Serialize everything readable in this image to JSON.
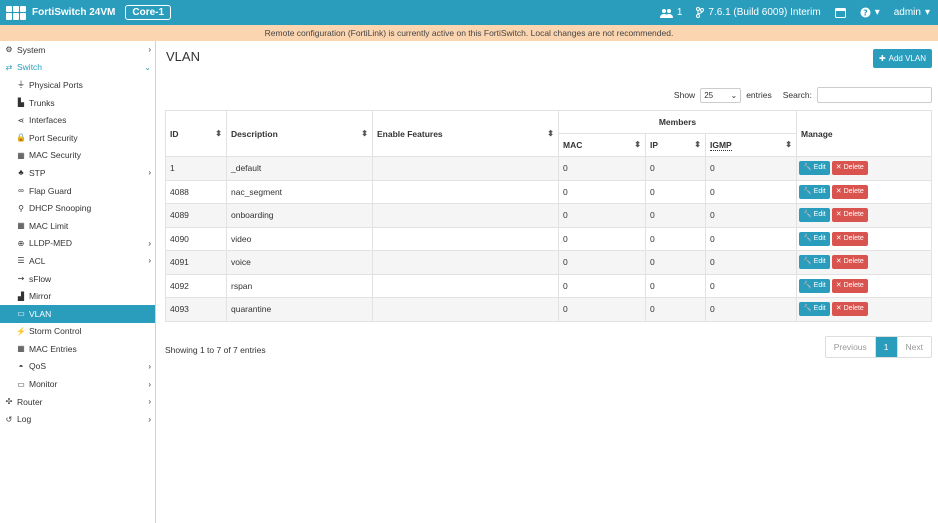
{
  "topbar": {
    "app_title": "FortiSwitch 24VM",
    "device": "Core-1",
    "users_count": "1",
    "version": "7.6.1 (Build 6009) Interim",
    "user": "admin",
    "icons": [
      "users-icon",
      "branch-icon",
      "terminal-icon",
      "help-icon",
      "caret-down-icon"
    ]
  },
  "banner": "Remote configuration (FortiLink) is currently active on this FortiSwitch. Local changes are not recommended.",
  "sidebar": {
    "items": [
      {
        "label": "System",
        "icon": "gear-icon",
        "type": "top",
        "chev": "›"
      },
      {
        "label": "Switch",
        "icon": "switch-icon",
        "type": "open",
        "chev": "⌄"
      },
      {
        "label": "Physical Ports",
        "icon": "port-icon",
        "type": "sub"
      },
      {
        "label": "Trunks",
        "icon": "trunk-icon",
        "type": "sub"
      },
      {
        "label": "Interfaces",
        "icon": "share-icon",
        "type": "sub"
      },
      {
        "label": "Port Security",
        "icon": "lock-icon",
        "type": "sub"
      },
      {
        "label": "MAC Security",
        "icon": "grid-icon",
        "type": "sub"
      },
      {
        "label": "STP",
        "icon": "tree-icon",
        "type": "sub",
        "chev": "›"
      },
      {
        "label": "Flap Guard",
        "icon": "link-icon",
        "type": "sub"
      },
      {
        "label": "DHCP Snooping",
        "icon": "search-icon",
        "type": "sub"
      },
      {
        "label": "MAC Limit",
        "icon": "grid-icon",
        "type": "sub"
      },
      {
        "label": "LLDP-MED",
        "icon": "zoom-icon",
        "type": "sub",
        "chev": "›"
      },
      {
        "label": "ACL",
        "icon": "list-icon",
        "type": "sub",
        "chev": "›"
      },
      {
        "label": "sFlow",
        "icon": "flow-icon",
        "type": "sub"
      },
      {
        "label": "Mirror",
        "icon": "chart-icon",
        "type": "sub"
      },
      {
        "label": "VLAN",
        "icon": "monitor-icon",
        "type": "active"
      },
      {
        "label": "Storm Control",
        "icon": "storm-icon",
        "type": "sub"
      },
      {
        "label": "MAC Entries",
        "icon": "grid-icon",
        "type": "sub"
      },
      {
        "label": "QoS",
        "icon": "gauge-icon",
        "type": "sub",
        "chev": "›"
      },
      {
        "label": "Monitor",
        "icon": "monitor-icon",
        "type": "sub",
        "chev": "›"
      },
      {
        "label": "Router",
        "icon": "router-icon",
        "type": "top",
        "chev": "›"
      },
      {
        "label": "Log",
        "icon": "history-icon",
        "type": "top",
        "chev": "›"
      }
    ]
  },
  "main": {
    "title": "VLAN",
    "add_button": "Add VLAN",
    "show_label": "Show",
    "entries_value": "25",
    "entries_label": "entries",
    "search_label": "Search:",
    "search_value": "",
    "columns": {
      "id": "ID",
      "description": "Description",
      "enable_features": "Enable Features",
      "members": "Members",
      "manage": "Manage",
      "mac": "MAC",
      "ip": "IP",
      "igmp": "IGMP"
    },
    "rows": [
      {
        "id": "1",
        "description": "_default",
        "features": "",
        "mac": "0",
        "ip": "0",
        "igmp": "0"
      },
      {
        "id": "4088",
        "description": "nac_segment",
        "features": "",
        "mac": "0",
        "ip": "0",
        "igmp": "0"
      },
      {
        "id": "4089",
        "description": "onboarding",
        "features": "",
        "mac": "0",
        "ip": "0",
        "igmp": "0"
      },
      {
        "id": "4090",
        "description": "video",
        "features": "",
        "mac": "0",
        "ip": "0",
        "igmp": "0"
      },
      {
        "id": "4091",
        "description": "voice",
        "features": "",
        "mac": "0",
        "ip": "0",
        "igmp": "0"
      },
      {
        "id": "4092",
        "description": "rspan",
        "features": "",
        "mac": "0",
        "ip": "0",
        "igmp": "0"
      },
      {
        "id": "4093",
        "description": "quarantine",
        "features": "",
        "mac": "0",
        "ip": "0",
        "igmp": "0"
      }
    ],
    "edit_label": "Edit",
    "delete_label": "Delete",
    "info": "Showing 1 to 7 of 7 entries",
    "pager": {
      "prev": "Previous",
      "current": "1",
      "next": "Next"
    }
  }
}
